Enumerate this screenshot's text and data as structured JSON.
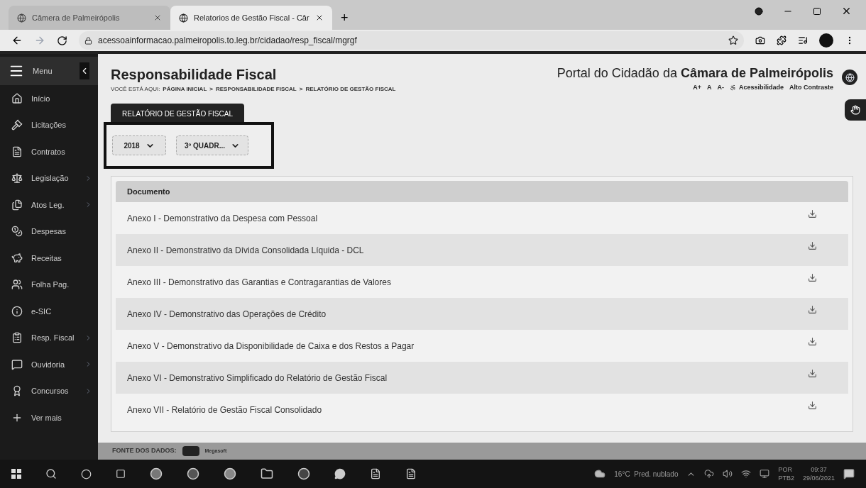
{
  "browser": {
    "tabs": [
      {
        "title": "Câmera de Palmeirópolis",
        "selected": false
      },
      {
        "title": "Relatorios de Gestão Fiscal - Câr",
        "selected": true
      }
    ],
    "new_tab": "+",
    "url": "acessoainformacao.palmeiropolis.to.leg.br/cidadao/resp_fiscal/mgrgf"
  },
  "sidebar": {
    "menu_label": "Menu",
    "items": [
      {
        "label": "Início",
        "expandable": false
      },
      {
        "label": "Licitações",
        "expandable": false
      },
      {
        "label": "Contratos",
        "expandable": false
      },
      {
        "label": "Legislação",
        "expandable": true
      },
      {
        "label": "Atos Leg.",
        "expandable": true
      },
      {
        "label": "Despesas",
        "expandable": false
      },
      {
        "label": "Receitas",
        "expandable": false
      },
      {
        "label": "Folha Pag.",
        "expandable": false
      },
      {
        "label": "e-SIC",
        "expandable": false
      },
      {
        "label": "Resp. Fiscal",
        "expandable": true
      },
      {
        "label": "Ouvidoria",
        "expandable": true
      },
      {
        "label": "Concursos",
        "expandable": true
      },
      {
        "label": "Ver mais",
        "expandable": false
      }
    ]
  },
  "header": {
    "title": "Responsabilidade Fiscal",
    "breadcrumb_prefix": "VOCÊ ESTÁ AQUI:",
    "breadcrumb": [
      "PÁGINA INICIAL",
      "RESPONSABILIDADE FISCAL",
      "RELATÓRIO DE GESTÃO FISCAL"
    ],
    "breadcrumb_separator": ">",
    "portal_title": "Portal do Cidadão da **Câmara de Palmeirópolis**",
    "font_controls": [
      "A+",
      "A",
      "A-"
    ],
    "accessibility": "Acessibilidade",
    "high_contrast": "Alto Contraste"
  },
  "tabs": [
    {
      "label": "RELATÓRIO DE GESTÃO FISCAL",
      "selected": true
    }
  ],
  "filters": [
    {
      "value": "2018"
    },
    {
      "value": "3º QUADR..."
    }
  ],
  "table": {
    "columns": [
      "Documento"
    ],
    "rows": [
      {
        "document": "Anexo I - Demonstrativo da Despesa com Pessoal"
      },
      {
        "document": "Anexo II - Demonstrativo da Dívida Consolidada Líquida - DCL"
      },
      {
        "document": "Anexo III - Demonstrativo das Garantias e Contragarantias de Valores"
      },
      {
        "document": "Anexo IV - Demonstrativo das Operações de Crédito"
      },
      {
        "document": "Anexo V - Demonstrativo da Disponibilidade de Caixa e dos Restos a Pagar"
      },
      {
        "document": "Anexo VI - Demonstrativo Simplificado do Relatório de Gestão Fiscal"
      },
      {
        "document": "Anexo VII - Relatório de Gestão Fiscal Consolidado"
      }
    ]
  },
  "footer": {
    "source_label": "FONTE DOS DADOS:",
    "source_name": "Megasoft"
  },
  "taskbar": {
    "weather": "16°C  Pred. nublado",
    "language": [
      "POR",
      "PTB2"
    ],
    "time": "09:37",
    "date": "29/06/2021"
  }
}
